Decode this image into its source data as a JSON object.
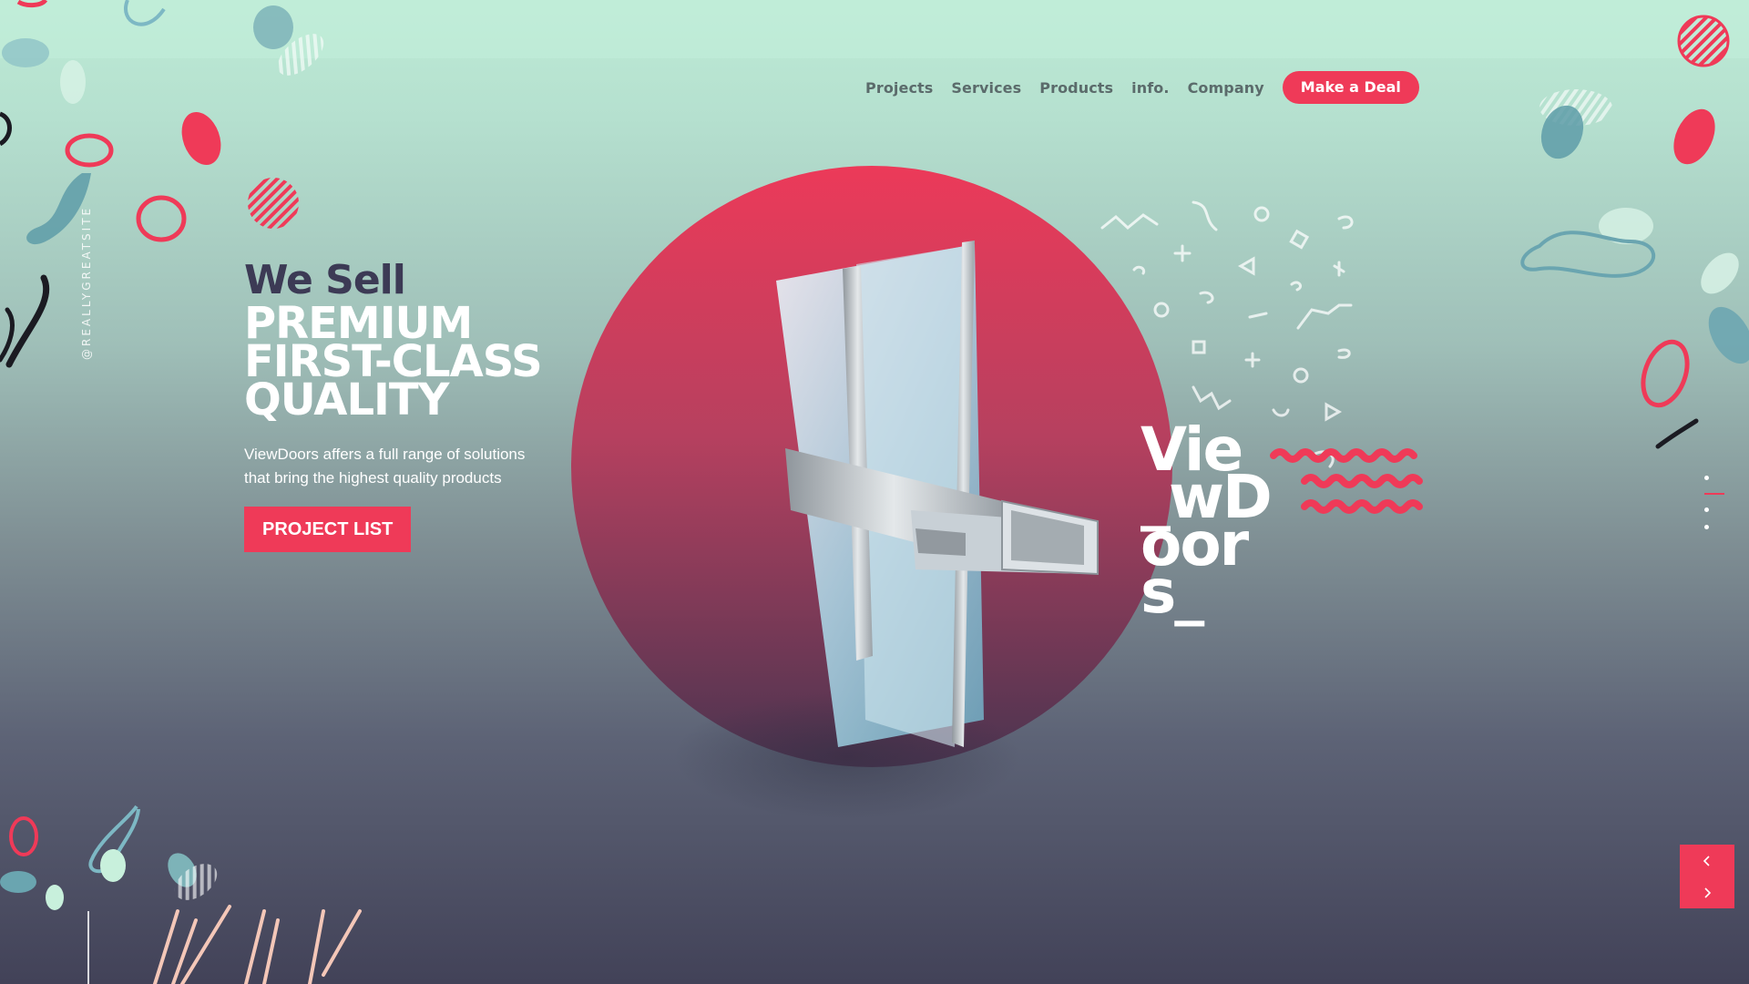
{
  "nav": {
    "items": [
      "Projects",
      "Services",
      "Products",
      "info.",
      "Company"
    ],
    "cta": "Make a Deal"
  },
  "handle": "@REALLYGREATSITE",
  "hero": {
    "pre": "We Sell",
    "headline": [
      "PREMIUM",
      "FIRST-CLASS",
      "QUALITY"
    ],
    "description": "ViewDoors affers a full range of solutions that bring the highest quality products",
    "button": "PROJECT LIST"
  },
  "brand_word": [
    "Vie",
    "_wD",
    "oor",
    "s_"
  ],
  "slider": {
    "dots": 4,
    "active_index": 1,
    "prev_icon": "chevron-left-icon",
    "next_icon": "chevron-right-icon"
  },
  "colors": {
    "accent": "#ef3a58",
    "mint": "#bdebd5",
    "dark": "#3c3a55"
  }
}
